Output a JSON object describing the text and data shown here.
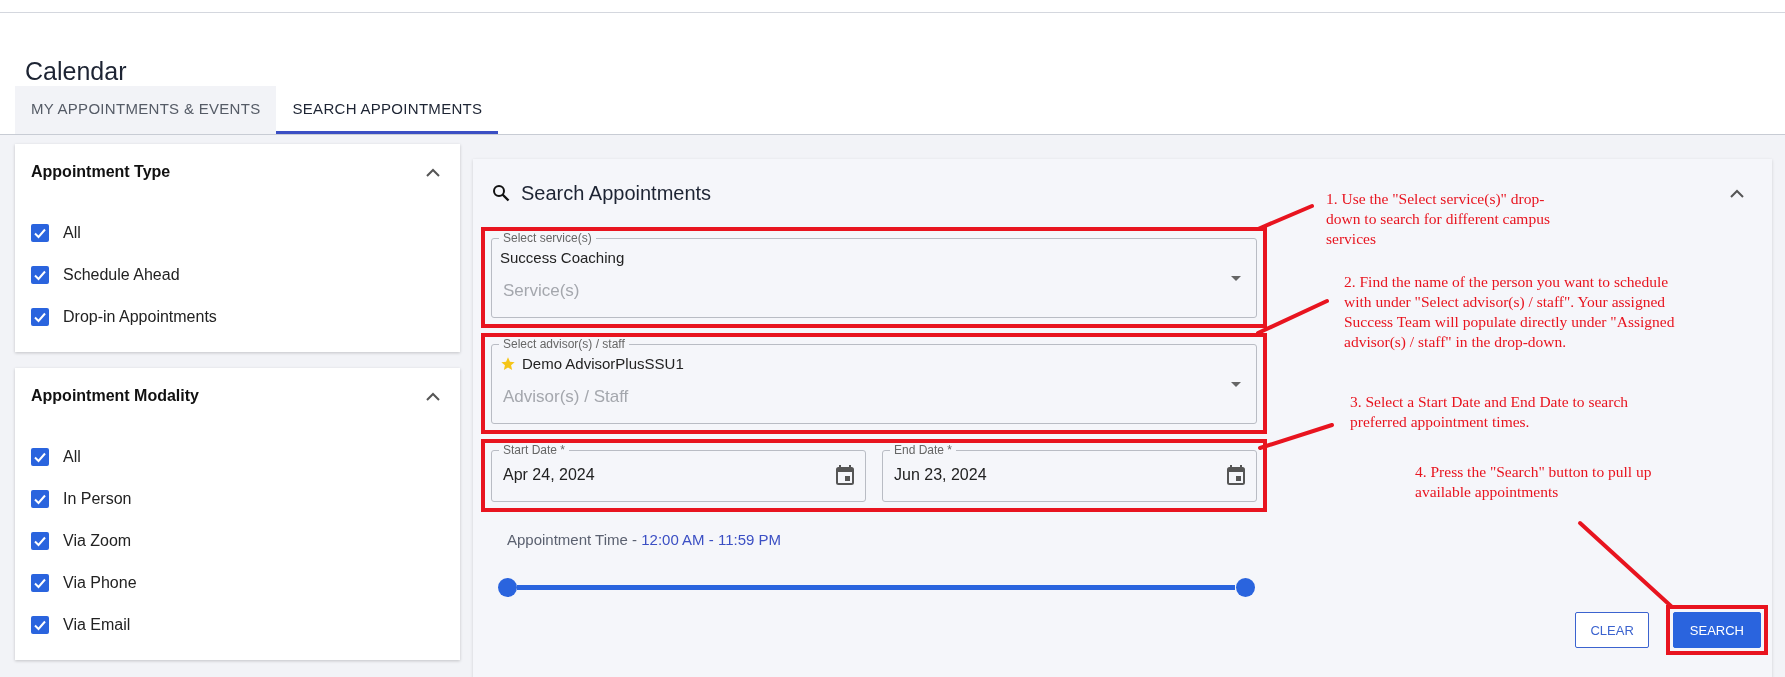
{
  "page_title": "Calendar",
  "tabs": [
    {
      "label": "MY APPOINTMENTS & EVENTS",
      "selected": false
    },
    {
      "label": "SEARCH APPOINTMENTS",
      "selected": true
    }
  ],
  "filter_panels": [
    {
      "title": "Appointment Type",
      "expanded": true,
      "options": [
        {
          "label": "All",
          "checked": true
        },
        {
          "label": "Schedule Ahead",
          "checked": true
        },
        {
          "label": "Drop-in Appointments",
          "checked": true
        }
      ]
    },
    {
      "title": "Appointment Modality",
      "expanded": true,
      "options": [
        {
          "label": "All",
          "checked": true
        },
        {
          "label": "In Person",
          "checked": true
        },
        {
          "label": "Via Zoom",
          "checked": true
        },
        {
          "label": "Via Phone",
          "checked": true
        },
        {
          "label": "Via Email",
          "checked": true
        }
      ]
    }
  ],
  "search_panel": {
    "title": "Search Appointments",
    "expanded": true,
    "rows": [
      {
        "highlighted": true,
        "fields": [
          {
            "kind": "select",
            "label": "Select service(s)",
            "value": "Success Coaching",
            "starred": false,
            "placeholder": "Service(s)"
          }
        ]
      },
      {
        "highlighted": true,
        "fields": [
          {
            "kind": "select",
            "label": "Select advisor(s) / staff",
            "value": "Demo AdvisorPlusSSU1",
            "starred": true,
            "placeholder": "Advisor(s) / Staff"
          }
        ]
      },
      {
        "highlighted": true,
        "fields": [
          {
            "kind": "date",
            "label": "Start Date *",
            "value": "Apr 24, 2024"
          },
          {
            "kind": "date",
            "label": "End Date *",
            "value": "Jun 23, 2024"
          }
        ]
      }
    ],
    "time_range": {
      "label": "Appointment Time - ",
      "value": "12:00 AM - 11:59 PM",
      "thumbs": [
        {
          "level": 0
        },
        {
          "level": 1
        }
      ]
    },
    "buttons": [
      {
        "label": "CLEAR",
        "kind": "outlined",
        "highlighted": false
      },
      {
        "label": "SEARCH",
        "kind": "primary",
        "highlighted": true
      }
    ]
  },
  "annotations": [
    {
      "text": "1. Use the \"Select service(s)\" drop-down to search for different campus services"
    },
    {
      "text": "2. Find the name of the person you want to schedule with under \"Select advisor(s) / staff\". Your assigned Success Team will populate directly under \"Assigned advisor(s) / staff\" in the drop-down."
    },
    {
      "text": "3. Select a Start Date and End Date to search preferred appointment times."
    },
    {
      "text": "4. Press the \"Search\" button to pull up available appointments"
    }
  ]
}
